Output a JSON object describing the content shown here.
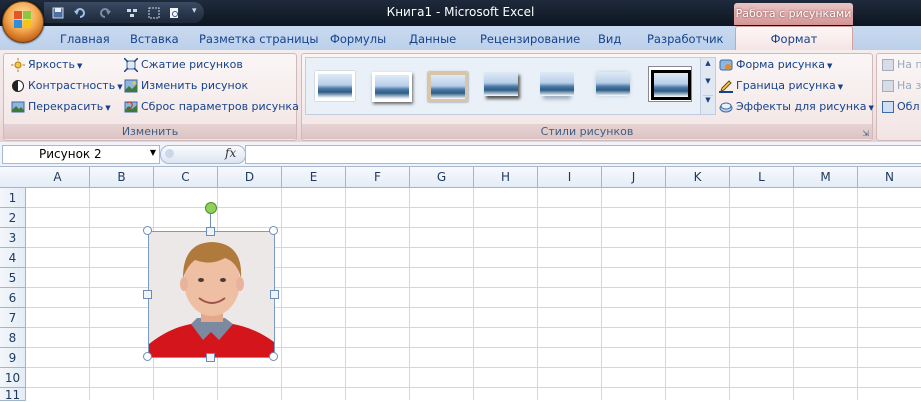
{
  "window": {
    "title": "Книга1 - Microsoft Excel",
    "context_tab": "Работа с рисунками"
  },
  "tabs": [
    {
      "label": "Главная"
    },
    {
      "label": "Вставка"
    },
    {
      "label": "Разметка страницы"
    },
    {
      "label": "Формулы"
    },
    {
      "label": "Данные"
    },
    {
      "label": "Рецензирование"
    },
    {
      "label": "Вид"
    },
    {
      "label": "Разработчик"
    },
    {
      "label": "Формат",
      "active": true
    }
  ],
  "ribbon": {
    "adjust": {
      "label": "Изменить",
      "brightness": "Яркость",
      "contrast": "Контрастность",
      "recolor": "Перекрасить",
      "compress": "Сжатие рисунков",
      "change": "Изменить рисунок",
      "reset": "Сброс параметров рисунка"
    },
    "styles": {
      "label": "Стили рисунков",
      "shape": "Форма рисунка",
      "border": "Граница рисунка",
      "effects": "Эффекты для рисунка"
    },
    "arrange": {
      "item1": "На п",
      "item2": "На з",
      "item3": "Обл"
    }
  },
  "formula_bar": {
    "name_box": "Рисунок 2",
    "fx": "fx",
    "value": ""
  },
  "columns": [
    "A",
    "B",
    "C",
    "D",
    "E",
    "F",
    "G",
    "H",
    "I",
    "J",
    "K",
    "L",
    "M",
    "N"
  ],
  "rows": [
    "1",
    "2",
    "3",
    "4",
    "5",
    "6",
    "7",
    "8",
    "9",
    "10",
    "11"
  ],
  "colors": {
    "accent": "#15428b",
    "context": "#d49494",
    "header_bg": "#e4ecf7"
  }
}
